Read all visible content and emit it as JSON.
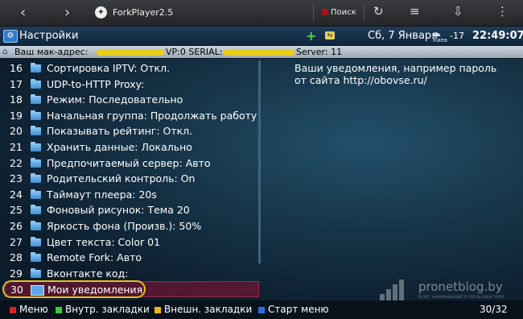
{
  "browser": {
    "back": "‹",
    "forward": "›",
    "logo": "✦",
    "title": "ForkPlayer2.5",
    "search_engine": "Я",
    "search_label": "Поиск",
    "refresh": "↻",
    "menu": "≡",
    "download": "⇩",
    "more": "⋮"
  },
  "appbar": {
    "title": "Настройки",
    "add": "+",
    "date": "Сб, 7 Января",
    "weather_city": "Киев",
    "temperature": "-17",
    "time": "22:49:07"
  },
  "address": {
    "text": "Ваш мак-адрес:",
    "vp": "VP:0 SERIAL:",
    "server": "Server: 11"
  },
  "settings": [
    {
      "num": "16",
      "label": "Сортировка IPTV: Откл."
    },
    {
      "num": "17",
      "label": "UDP-to-HTTP Proxy:"
    },
    {
      "num": "18",
      "label": "Режим: Последовательно"
    },
    {
      "num": "19",
      "label": "Начальная группа: Продолжать работу с"
    },
    {
      "num": "20",
      "label": "Показывать рейтинг: Откл."
    },
    {
      "num": "21",
      "label": "Хранить данные: Локально"
    },
    {
      "num": "22",
      "label": "Предпочитаемый сервер: Авто"
    },
    {
      "num": "23",
      "label": "Родительский контроль: On"
    },
    {
      "num": "24",
      "label": "Таймаут плеера: 20s"
    },
    {
      "num": "25",
      "label": "Фоновый рисунок: Тема 20"
    },
    {
      "num": "26",
      "label": "Яркость фона (Произв.): 50%"
    },
    {
      "num": "27",
      "label": "Цвет текста: Color 01"
    },
    {
      "num": "28",
      "label": "Remote Fork: Авто"
    },
    {
      "num": "29",
      "label": "Вконтакте код:"
    },
    {
      "num": "30",
      "label": "Мои уведомления"
    }
  ],
  "description": "Ваши уведомления, например пароль от сайта http://obovse.ru/",
  "watermark": {
    "brand": "pronetblog.by",
    "tagline": "Блог начинающего пользователя"
  },
  "bottombar": {
    "items": [
      {
        "color": "#e02020",
        "label": "Меню"
      },
      {
        "color": "#3cc83c",
        "label": "Внутр. закладки"
      },
      {
        "color": "#e8b818",
        "label": "Внешн. закладки"
      },
      {
        "color": "#2a6ee6",
        "label": "Старт меню"
      }
    ],
    "pages": "30/32"
  },
  "colors": {
    "selected_row": "#8c1432",
    "highlight_oval": "#e3c21e",
    "folder_icon": "#5aa8e6",
    "redaction": "#e8cd1a"
  }
}
